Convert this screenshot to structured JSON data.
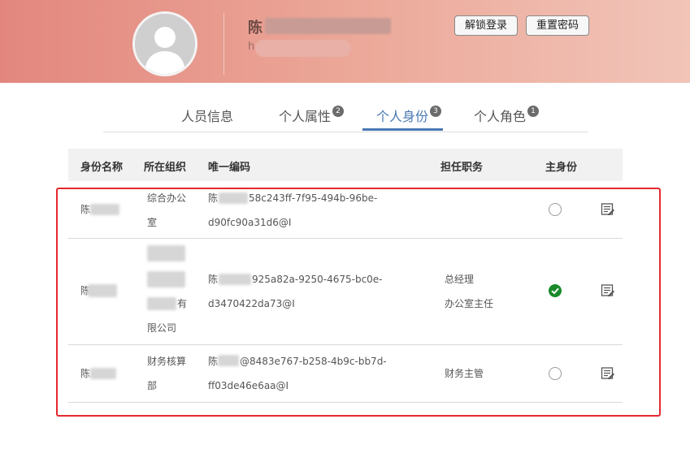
{
  "profile": {
    "name_prefix": "陈",
    "sub_prefix": "h"
  },
  "header_buttons": {
    "unlock": "解锁登录",
    "reset_password": "重置密码"
  },
  "tabs": [
    {
      "label": "人员信息",
      "badge": ""
    },
    {
      "label": "个人属性",
      "badge": "2"
    },
    {
      "label": "个人身份",
      "badge": "3",
      "active": true
    },
    {
      "label": "个人角色",
      "badge": "1"
    }
  ],
  "table": {
    "headers": [
      "身份名称",
      "所在组织",
      "唯一编码",
      "担任职务",
      "主身份"
    ],
    "rows": [
      {
        "name": "陈",
        "org_line1": "综合办公",
        "org_line2": "室",
        "code_line1_prefix": "陈",
        "code_line1_suffix": "58c243ff-7f95-494b-96be-",
        "code_line2": "d90fc90a31d6@I",
        "position_line1": "",
        "position_line2": "",
        "is_primary": false
      },
      {
        "name": "陈",
        "org_line3_suffix": "有",
        "org_line4": "限公司",
        "code_line1_prefix": "陈",
        "code_line1_suffix": "925a82a-9250-4675-bc0e-",
        "code_line2": "d3470422da73@I",
        "position_line1": "总经理",
        "position_line2": "办公室主任",
        "is_primary": true
      },
      {
        "name": "陈",
        "org_line1": "财务核算",
        "org_line2": "部",
        "code_line1_prefix": "陈",
        "code_line1_suffix": "@8483e767-b258-4b9c-bb7d-",
        "code_line2": "ff03de46e6aa@I",
        "position_line1": "财务主管",
        "is_primary": false
      }
    ]
  },
  "colors": {
    "accent": "#4a78b5",
    "primary_check": "#1a8a2a",
    "highlight_box": "#e5282e"
  }
}
